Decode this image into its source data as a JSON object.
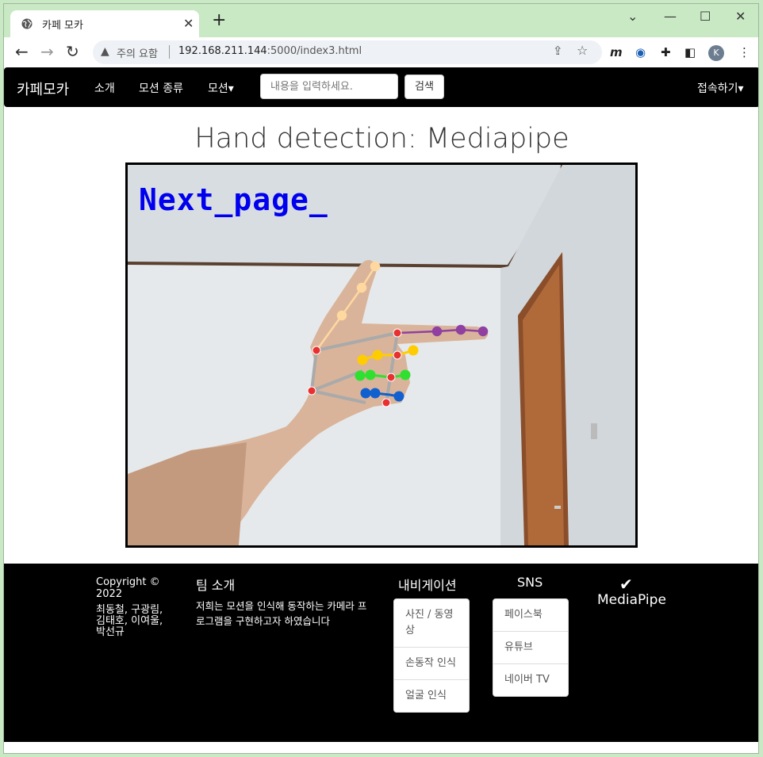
{
  "browser": {
    "tab_title": "카페 모카",
    "security_label": "주의 요함",
    "url_host": "192.168.211.144",
    "url_path": ":5000/index3.html",
    "avatar_letter": "K"
  },
  "site": {
    "brand": "카페모카",
    "nav": [
      "소개",
      "모션 종류",
      "모션"
    ],
    "dropdown_caret": "▾",
    "search_placeholder": "내용을 입력하세요.",
    "search_button": "검색",
    "login": "접속하기"
  },
  "main": {
    "title": "Hand detection: Mediapipe",
    "overlay_text": "Next_page_"
  },
  "footer": {
    "copyright": "Copyright © 2022",
    "members": "최동철, 구광림, 김태호, 이여울, 박선규",
    "team_heading": "팀 소개",
    "team_text": "저희는 모션을 인식해 동작하는 카메라 프로그램을 구현하고자 하였습니다",
    "nav_heading": "내비게이션",
    "nav_items": [
      "사진 / 동영상",
      "손동작 인식",
      "얼굴 인식"
    ],
    "sns_heading": "SNS",
    "sns_items": [
      "페이스북",
      "유튜브",
      "네이버 TV"
    ],
    "mediapipe_label": "MediaPipe"
  },
  "colors": {
    "overlay_text": "#0000ee",
    "thumb": "#ffd8a0",
    "index": "#9040a0",
    "middle": "#ffcc00",
    "ring": "#30e030",
    "pinky": "#1060d0",
    "palm": "#e83030"
  }
}
